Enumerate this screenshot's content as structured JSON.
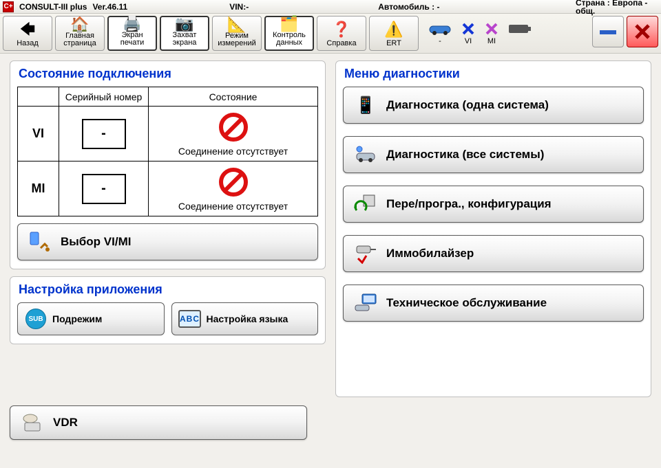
{
  "header": {
    "app_name": "CONSULT-III plus",
    "version_label": "Ver.46.11",
    "vin_label": "VIN:-",
    "vehicle_label": "Автомобиль : -",
    "country_label": "Страна : Европа - общ."
  },
  "toolbar": {
    "back": "Назад",
    "home": "Главная страница",
    "print": "Экран печати",
    "capture": "Захват экрана",
    "measure": "Режим измерений",
    "recorded": "Контроль данных",
    "help": "Справка",
    "ert": "ERT"
  },
  "status": {
    "car_label": "-",
    "vi_label": "VI",
    "mi_label": "MI"
  },
  "connection": {
    "title": "Состояние подключения",
    "col_empty": "",
    "col_serial": "Серийный номер",
    "col_state": "Состояние",
    "rows": [
      {
        "label": "VI",
        "serial": "-",
        "state": "Соединение отсутствует"
      },
      {
        "label": "MI",
        "serial": "-",
        "state": "Соединение отсутствует"
      }
    ],
    "select_label": "Выбор VI/MI"
  },
  "appset": {
    "title": "Настройка приложения",
    "submode": "Подрежим",
    "lang": "Настройка языка",
    "sub_badge": "SUB",
    "abc_badge": "ABC"
  },
  "vdr": {
    "label": "VDR"
  },
  "diag": {
    "title": "Меню диагностики",
    "one_system": "Диагностика (одна система)",
    "all_systems": "Диагностика (все системы)",
    "reprog": "Пере/програ., конфигурация",
    "immo": "Иммобилайзер",
    "maint": "Техническое обслуживание"
  }
}
